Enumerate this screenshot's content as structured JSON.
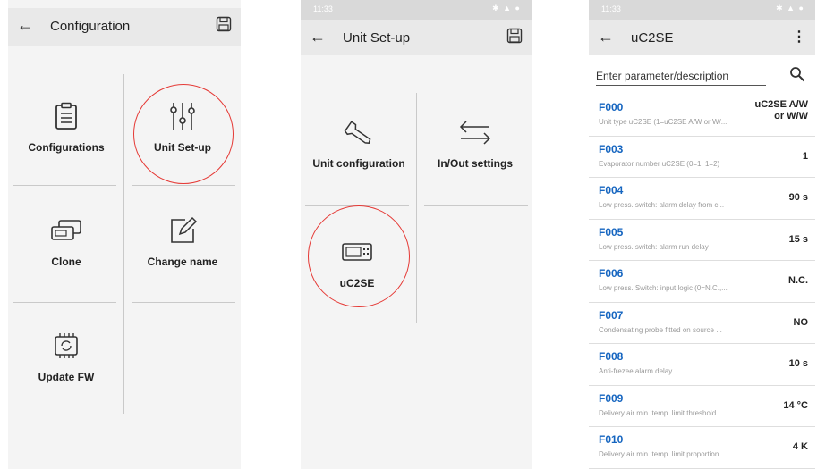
{
  "colors": {
    "accent": "#1565c0",
    "highlight_circle": "#e53935",
    "status_bar": "#d9d9d9",
    "app_bar": "#e9e9e9"
  },
  "screen1": {
    "title": "Configuration",
    "tiles": [
      {
        "label": "Configurations",
        "icon": "clipboard-icon"
      },
      {
        "label": "Unit Set-up",
        "icon": "sliders-icon"
      },
      {
        "label": "Clone",
        "icon": "clone-devices-icon"
      },
      {
        "label": "Change name",
        "icon": "edit-icon"
      },
      {
        "label": "Update FW",
        "icon": "chip-refresh-icon"
      }
    ]
  },
  "screen2": {
    "status_time": "11:33",
    "title": "Unit Set-up",
    "tiles": [
      {
        "label": "Unit configuration",
        "icon": "wrench-icon"
      },
      {
        "label": "In/Out settings",
        "icon": "swap-arrows-icon"
      },
      {
        "label": "uC2SE",
        "icon": "controller-device-icon"
      }
    ]
  },
  "screen3": {
    "status_time": "11:33",
    "title": "uC2SE",
    "search_placeholder": "Enter parameter/description",
    "params": [
      {
        "code": "F000",
        "desc": "Unit type uC2SE (1=uC2SE A/W or W/...",
        "value": "uC2SE A/W\nor W/W"
      },
      {
        "code": "F003",
        "desc": "Evaporator number uC2SE (0=1, 1=2)",
        "value": "1"
      },
      {
        "code": "F004",
        "desc": "Low press. switch: alarm delay from c...",
        "value": "90 s"
      },
      {
        "code": "F005",
        "desc": "Low press. switch: alarm run delay",
        "value": "15 s"
      },
      {
        "code": "F006",
        "desc": "Low press. Switch: input logic (0=N.C.,...",
        "value": "N.C."
      },
      {
        "code": "F007",
        "desc": "Condensating probe fitted on source ...",
        "value": "NO"
      },
      {
        "code": "F008",
        "desc": "Anti-frezee alarm delay",
        "value": "10 s"
      },
      {
        "code": "F009",
        "desc": "Delivery air min. temp. limit threshold",
        "value": "14 °C"
      },
      {
        "code": "F010",
        "desc": "Delivery air min. temp. limit proportion...",
        "value": "4 K"
      }
    ]
  }
}
